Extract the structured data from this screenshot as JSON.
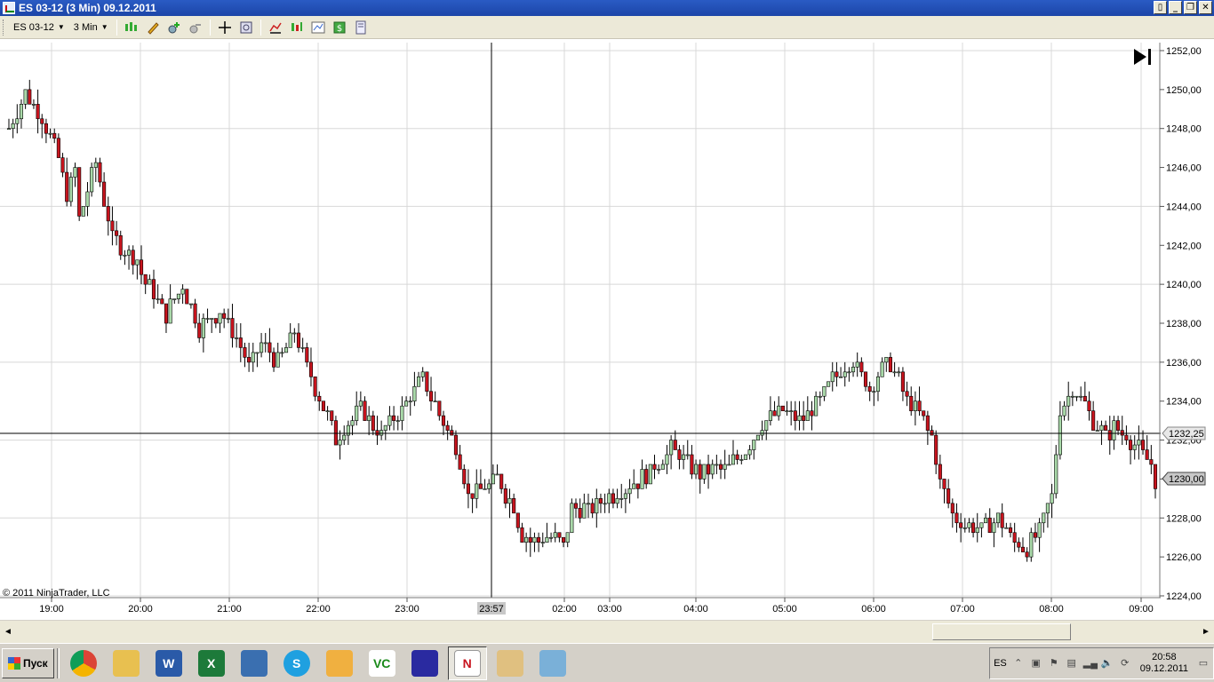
{
  "window": {
    "title": "ES 03-12 (3 Min)  09.12.2011"
  },
  "toolbar": {
    "instrument": "ES 03-12",
    "interval": "3 Min"
  },
  "chart": {
    "watermark": "© 2011 NinjaTrader, LLC",
    "crosshair_time": "23:57",
    "crosshair_price": "1232,25",
    "last_price": "1230,00",
    "colors": {
      "up": "#a9d9a9",
      "down": "#c8141e",
      "grid": "#d8d8d8",
      "line": "#000000"
    }
  },
  "chart_data": {
    "type": "candlestick",
    "ylim": [
      1224,
      1252
    ],
    "y_ticks": [
      "1224,00",
      "1226,00",
      "1228,00",
      "1230,00",
      "1232,00",
      "1234,00",
      "1236,00",
      "1238,00",
      "1240,00",
      "1242,00",
      "1244,00",
      "1246,00",
      "1248,00",
      "1250,00",
      "1252,00"
    ],
    "x_ticks": [
      "19:00",
      "20:00",
      "21:00",
      "22:00",
      "23:00",
      "02:00",
      "03:00",
      "04:00",
      "05:00",
      "06:00",
      "07:00",
      "08:00",
      "09:00"
    ],
    "close_path": [
      [
        0,
        1248
      ],
      [
        4,
        1249.8
      ],
      [
        8,
        1248.6
      ],
      [
        12,
        1246.4
      ],
      [
        14,
        1244.7
      ],
      [
        16,
        1245.8
      ],
      [
        17,
        1243.4
      ],
      [
        21,
        1246.2
      ],
      [
        25,
        1242.4
      ],
      [
        31,
        1241.2
      ],
      [
        33,
        1240.1
      ],
      [
        38,
        1238.5
      ],
      [
        42,
        1239.9
      ],
      [
        46,
        1237.8
      ],
      [
        51,
        1238.6
      ],
      [
        54,
        1237.6
      ],
      [
        58,
        1235.8
      ],
      [
        61,
        1236.9
      ],
      [
        65,
        1236
      ],
      [
        69,
        1237.6
      ],
      [
        72,
        1235.7
      ],
      [
        77,
        1233.2
      ],
      [
        79,
        1232.1
      ],
      [
        85,
        1233.6
      ],
      [
        90,
        1232.3
      ],
      [
        96,
        1233.9
      ],
      [
        100,
        1235.2
      ],
      [
        104,
        1233.3
      ],
      [
        108,
        1231.8
      ],
      [
        111,
        1229.2
      ],
      [
        115,
        1229.6
      ],
      [
        118,
        1230
      ],
      [
        122,
        1228.5
      ],
      [
        124,
        1227.1
      ],
      [
        127,
        1226.8
      ],
      [
        131,
        1227.1
      ],
      [
        134,
        1226.5
      ],
      [
        136,
        1228.6
      ],
      [
        140,
        1228.4
      ],
      [
        146,
        1229.2
      ],
      [
        154,
        1230.2
      ],
      [
        160,
        1231.5
      ],
      [
        163,
        1231.1
      ],
      [
        167,
        1230.2
      ],
      [
        174,
        1230.7
      ],
      [
        178,
        1231.6
      ],
      [
        182,
        1232.8
      ],
      [
        186,
        1233.5
      ],
      [
        192,
        1233
      ],
      [
        196,
        1234.1
      ],
      [
        199,
        1235.2
      ],
      [
        204,
        1236.1
      ],
      [
        208,
        1234.6
      ],
      [
        210,
        1235.5
      ],
      [
        213,
        1236
      ],
      [
        217,
        1234.1
      ],
      [
        221,
        1233
      ],
      [
        223,
        1232.1
      ],
      [
        225,
        1229.8
      ],
      [
        228,
        1228.2
      ],
      [
        231,
        1227.6
      ],
      [
        235,
        1227.4
      ],
      [
        239,
        1228
      ],
      [
        243,
        1226.8
      ],
      [
        246,
        1226.4
      ],
      [
        249,
        1227.4
      ],
      [
        252,
        1229.1
      ],
      [
        254,
        1233.7
      ],
      [
        257,
        1234.6
      ],
      [
        260,
        1233.9
      ],
      [
        262,
        1233
      ],
      [
        265,
        1232.2
      ],
      [
        267,
        1232.6
      ],
      [
        270,
        1232.2
      ],
      [
        273,
        1231.6
      ],
      [
        276,
        1230.7
      ],
      [
        277,
        1230
      ]
    ],
    "n_bars": 278
  },
  "scrollbar": {
    "left_arrow": "◄",
    "right_arrow": "►"
  },
  "taskbar": {
    "start_label": "Пуск",
    "apps": [
      {
        "name": "chrome",
        "label": "",
        "color": "#e8a020"
      },
      {
        "name": "explorer",
        "label": "",
        "color": "#e8c050"
      },
      {
        "name": "word",
        "label": "W",
        "color": "#2a5aa8"
      },
      {
        "name": "excel",
        "label": "X",
        "color": "#1d7a3a"
      },
      {
        "name": "thunderbird",
        "label": "",
        "color": "#3a6fb0"
      },
      {
        "name": "skype",
        "label": "S",
        "color": "#1fa0e0"
      },
      {
        "name": "outlook",
        "label": "",
        "color": "#f0b040"
      },
      {
        "name": "vc",
        "label": "VC",
        "color": "#ffffff"
      },
      {
        "name": "app7",
        "label": "",
        "color": "#2a2aa0"
      },
      {
        "name": "ninjatrader",
        "label": "",
        "color": "#ffffff"
      },
      {
        "name": "paint",
        "label": "",
        "color": "#e0c080"
      },
      {
        "name": "notepad",
        "label": "",
        "color": "#7ab0d8"
      }
    ],
    "tray_lang": "ES",
    "clock_time": "20:58",
    "clock_date": "09.12.2011"
  }
}
